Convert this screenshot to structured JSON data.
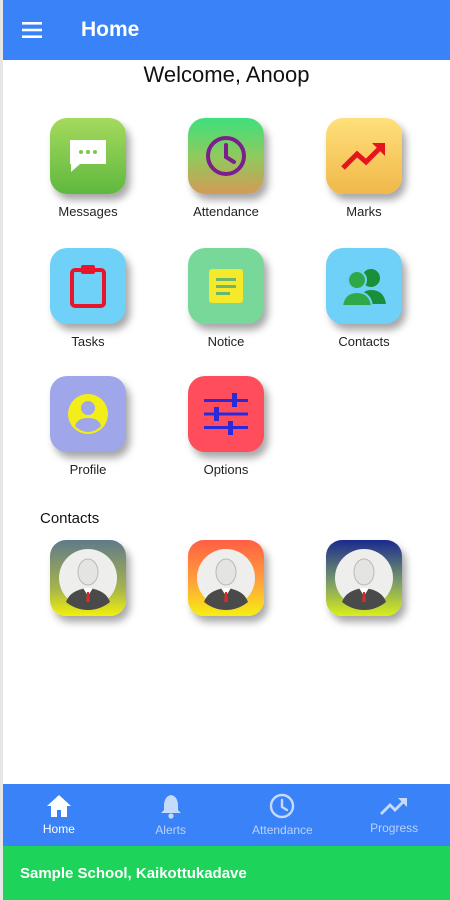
{
  "appbar": {
    "title": "Home",
    "menu_icon": "hamburger-icon"
  },
  "welcome": "Welcome, Anoop",
  "tiles": [
    {
      "label": "Messages",
      "icon": "chat-bubble-icon"
    },
    {
      "label": "Attendance",
      "icon": "clock-icon"
    },
    {
      "label": "Marks",
      "icon": "trending-up-icon"
    },
    {
      "label": "Tasks",
      "icon": "clipboard-icon"
    },
    {
      "label": "Notice",
      "icon": "note-icon"
    },
    {
      "label": "Contacts",
      "icon": "people-icon"
    },
    {
      "label": "Profile",
      "icon": "account-circle-icon"
    },
    {
      "label": "Options",
      "icon": "sliders-icon"
    }
  ],
  "contacts_heading": "Contacts",
  "bottom_nav": [
    {
      "label": "Home",
      "icon": "home-icon",
      "active": true
    },
    {
      "label": "Alerts",
      "icon": "bell-icon",
      "active": false
    },
    {
      "label": "Attendance",
      "icon": "clock-icon",
      "active": false
    },
    {
      "label": "Progress",
      "icon": "trending-up-icon",
      "active": false
    }
  ],
  "footer": {
    "school": "Sample School, Kaikottukadave"
  },
  "colors": {
    "primary": "#3a82f7",
    "footer": "#1ed35a"
  }
}
